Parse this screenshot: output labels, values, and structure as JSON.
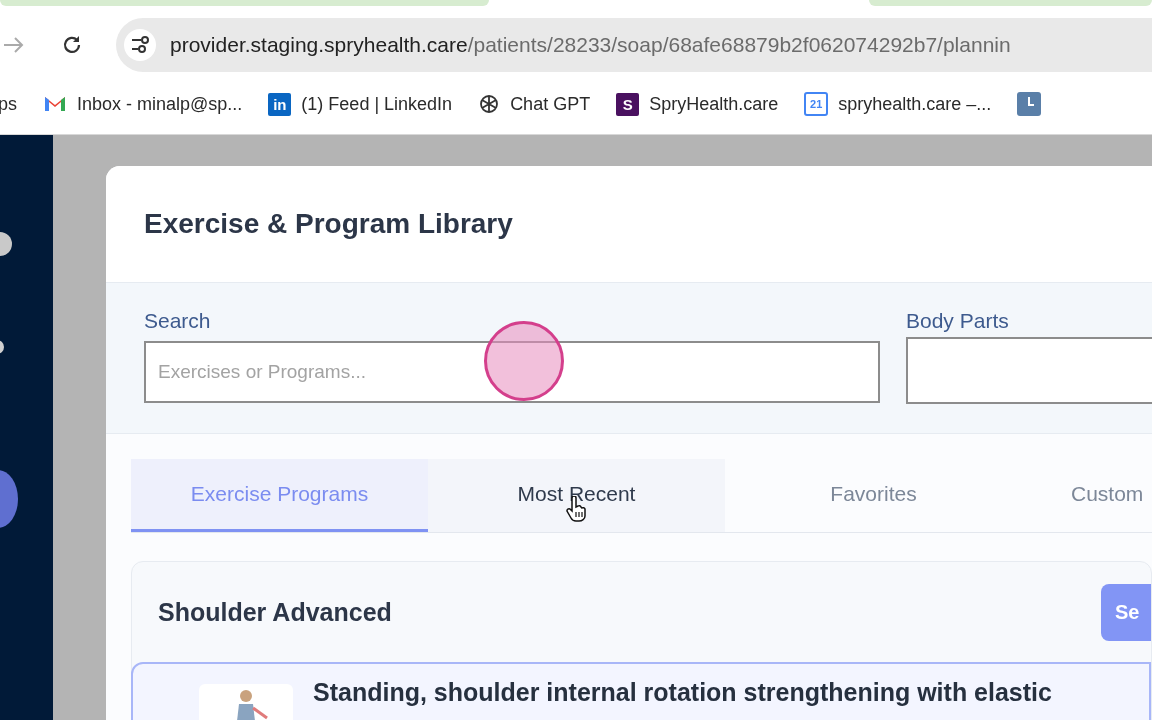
{
  "browser": {
    "url_host": "provider.staging.spryhealth.care",
    "url_path": "/patients/28233/soap/68afe68879b2f062074292b7/plannin",
    "bookmarks": [
      {
        "label": "ps",
        "kind": "plain"
      },
      {
        "label": "Inbox - minalp@sp...",
        "kind": "mail"
      },
      {
        "label": "(1) Feed | LinkedIn",
        "kind": "badge",
        "badge": "in",
        "color": "#0a66c2"
      },
      {
        "label": "Chat GPT",
        "kind": "knot"
      },
      {
        "label": "SpryHealth.care",
        "kind": "badge",
        "badge": "S",
        "color": "#4a1160"
      },
      {
        "label": "spryhealth.care –...",
        "kind": "calendar",
        "badge": "21"
      },
      {
        "kind": "clock"
      }
    ]
  },
  "library": {
    "title": "Exercise & Program Library",
    "search": {
      "label": "Search",
      "placeholder": "Exercises or Programs..."
    },
    "body_parts": {
      "label": "Body Parts"
    },
    "tabs": [
      {
        "label": "Exercise Programs",
        "selected": true,
        "hovered": false
      },
      {
        "label": "Most Recent",
        "selected": false,
        "hovered": true
      },
      {
        "label": "Favorites",
        "selected": false,
        "hovered": false
      },
      {
        "label": "Custom",
        "selected": false,
        "hovered": false
      }
    ],
    "program": {
      "title": "Shoulder Advanced",
      "button": "Se",
      "exercise": {
        "title": "Standing, shoulder internal rotation strengthening with elastic"
      }
    }
  }
}
